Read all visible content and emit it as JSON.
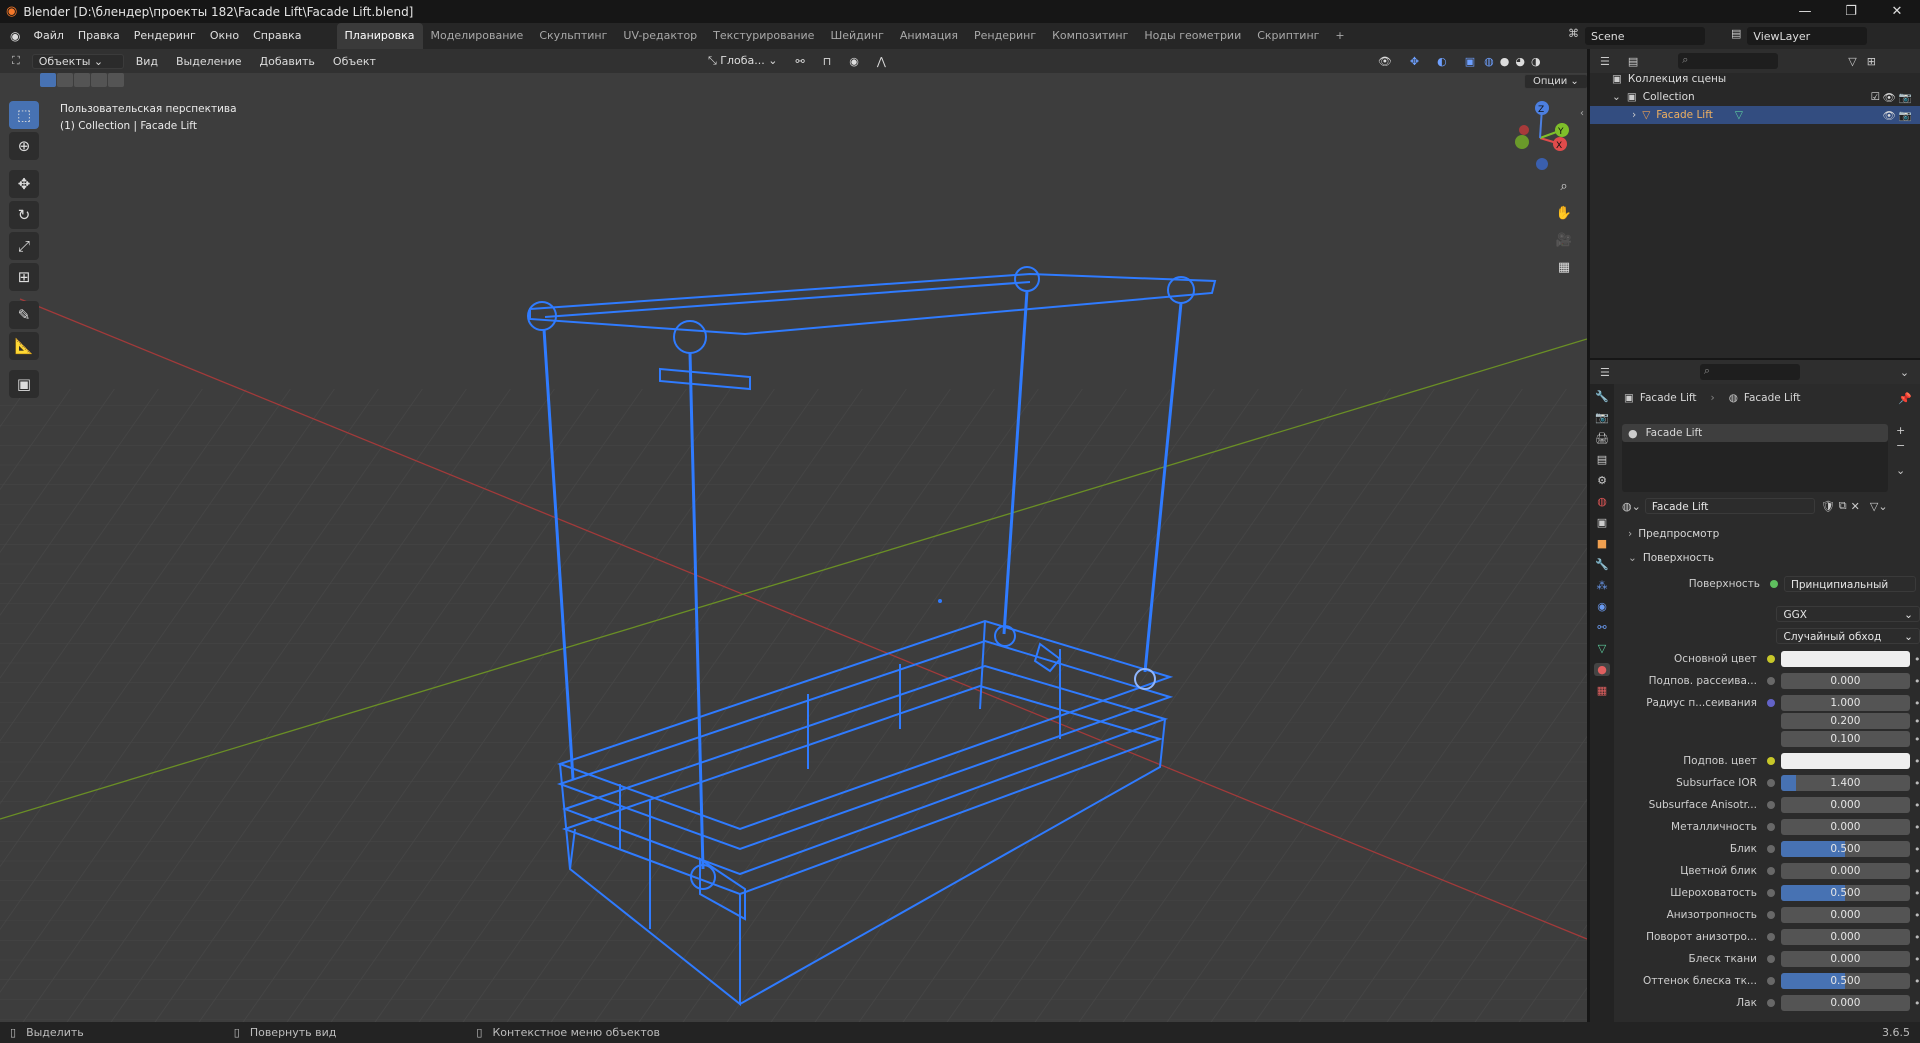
{
  "window": {
    "title": "Blender [D:\\блендер\\проекты 182\\Facade Lift\\Facade Lift.blend]",
    "controls": [
      "—",
      "❐",
      "✕"
    ]
  },
  "menu": [
    "Файл",
    "Правка",
    "Рендеринг",
    "Окно",
    "Справка"
  ],
  "workspaces": [
    "Планировка",
    "Моделирование",
    "Скульптинг",
    "UV-редактор",
    "Текстурирование",
    "Шейдинг",
    "Анимация",
    "Рендеринг",
    "Композитинг",
    "Ноды геометрии",
    "Скриптинг"
  ],
  "add_tab": "+",
  "scene": {
    "name": "Scene",
    "view_layer": "ViewLayer"
  },
  "viewport": {
    "mode": "Объекты",
    "menus": [
      "Вид",
      "Выделение",
      "Добавить",
      "Объект"
    ],
    "transform": "Глоба...",
    "options": "Опции",
    "info_line1": "Пользовательская перспектива",
    "info_line2": "(1) Collection | Facade Lift",
    "gizmo": {
      "x": "X",
      "y": "Y",
      "z": "Z"
    }
  },
  "outliner": {
    "root": "Коллекция сцены",
    "collection": "Collection",
    "object": "Facade Lift"
  },
  "properties": {
    "breadcrumb_object": "Facade Lift",
    "breadcrumb_material": "Facade Lift",
    "slot": "Facade Lift",
    "material_name": "Facade Lift",
    "preview_section": "Предпросмотр",
    "surface_section": "Поверхность",
    "surface_label": "Поверхность",
    "surface_value": "Принципиальный BSDF",
    "distribution": "GGX",
    "subsurface_method": "Случайный обход",
    "rows": [
      {
        "label": "Основной цвет",
        "value": "",
        "type": "color",
        "dot": "yel"
      },
      {
        "label": "Подпов. рассеива...",
        "value": "0.000",
        "type": "num",
        "dot": "gray"
      },
      {
        "label": "Радиус п...сеивания",
        "value": "1.000",
        "type": "num",
        "dot": "purp"
      },
      {
        "label": "",
        "value": "0.200",
        "type": "num",
        "dot": "none"
      },
      {
        "label": "",
        "value": "0.100",
        "type": "num",
        "dot": "none"
      },
      {
        "label": "Подпов. цвет",
        "value": "",
        "type": "color",
        "dot": "yel"
      },
      {
        "label": "Subsurface IOR",
        "value": "1.400",
        "type": "num",
        "dot": "gray",
        "fill": 0.12
      },
      {
        "label": "Subsurface Anisotr...",
        "value": "0.000",
        "type": "num",
        "dot": "gray"
      },
      {
        "label": "Металличность",
        "value": "0.000",
        "type": "num",
        "dot": "gray"
      },
      {
        "label": "Блик",
        "value": "0.500",
        "type": "num",
        "dot": "gray",
        "fill": 0.5
      },
      {
        "label": "Цветной блик",
        "value": "0.000",
        "type": "num",
        "dot": "gray"
      },
      {
        "label": "Шероховатость",
        "value": "0.500",
        "type": "num",
        "dot": "gray",
        "fill": 0.5
      },
      {
        "label": "Анизотропность",
        "value": "0.000",
        "type": "num",
        "dot": "gray"
      },
      {
        "label": "Поворот анизотро...",
        "value": "0.000",
        "type": "num",
        "dot": "gray"
      },
      {
        "label": "Блеск ткани",
        "value": "0.000",
        "type": "num",
        "dot": "gray"
      },
      {
        "label": "Оттенок блеска тк...",
        "value": "0.500",
        "type": "num",
        "dot": "gray",
        "fill": 0.5
      },
      {
        "label": "Лак",
        "value": "0.000",
        "type": "num",
        "dot": "gray"
      }
    ]
  },
  "status": {
    "select": "Выделить",
    "rotate": "Повернуть вид",
    "context": "Контекстное меню объектов",
    "version": "3.6.5"
  }
}
